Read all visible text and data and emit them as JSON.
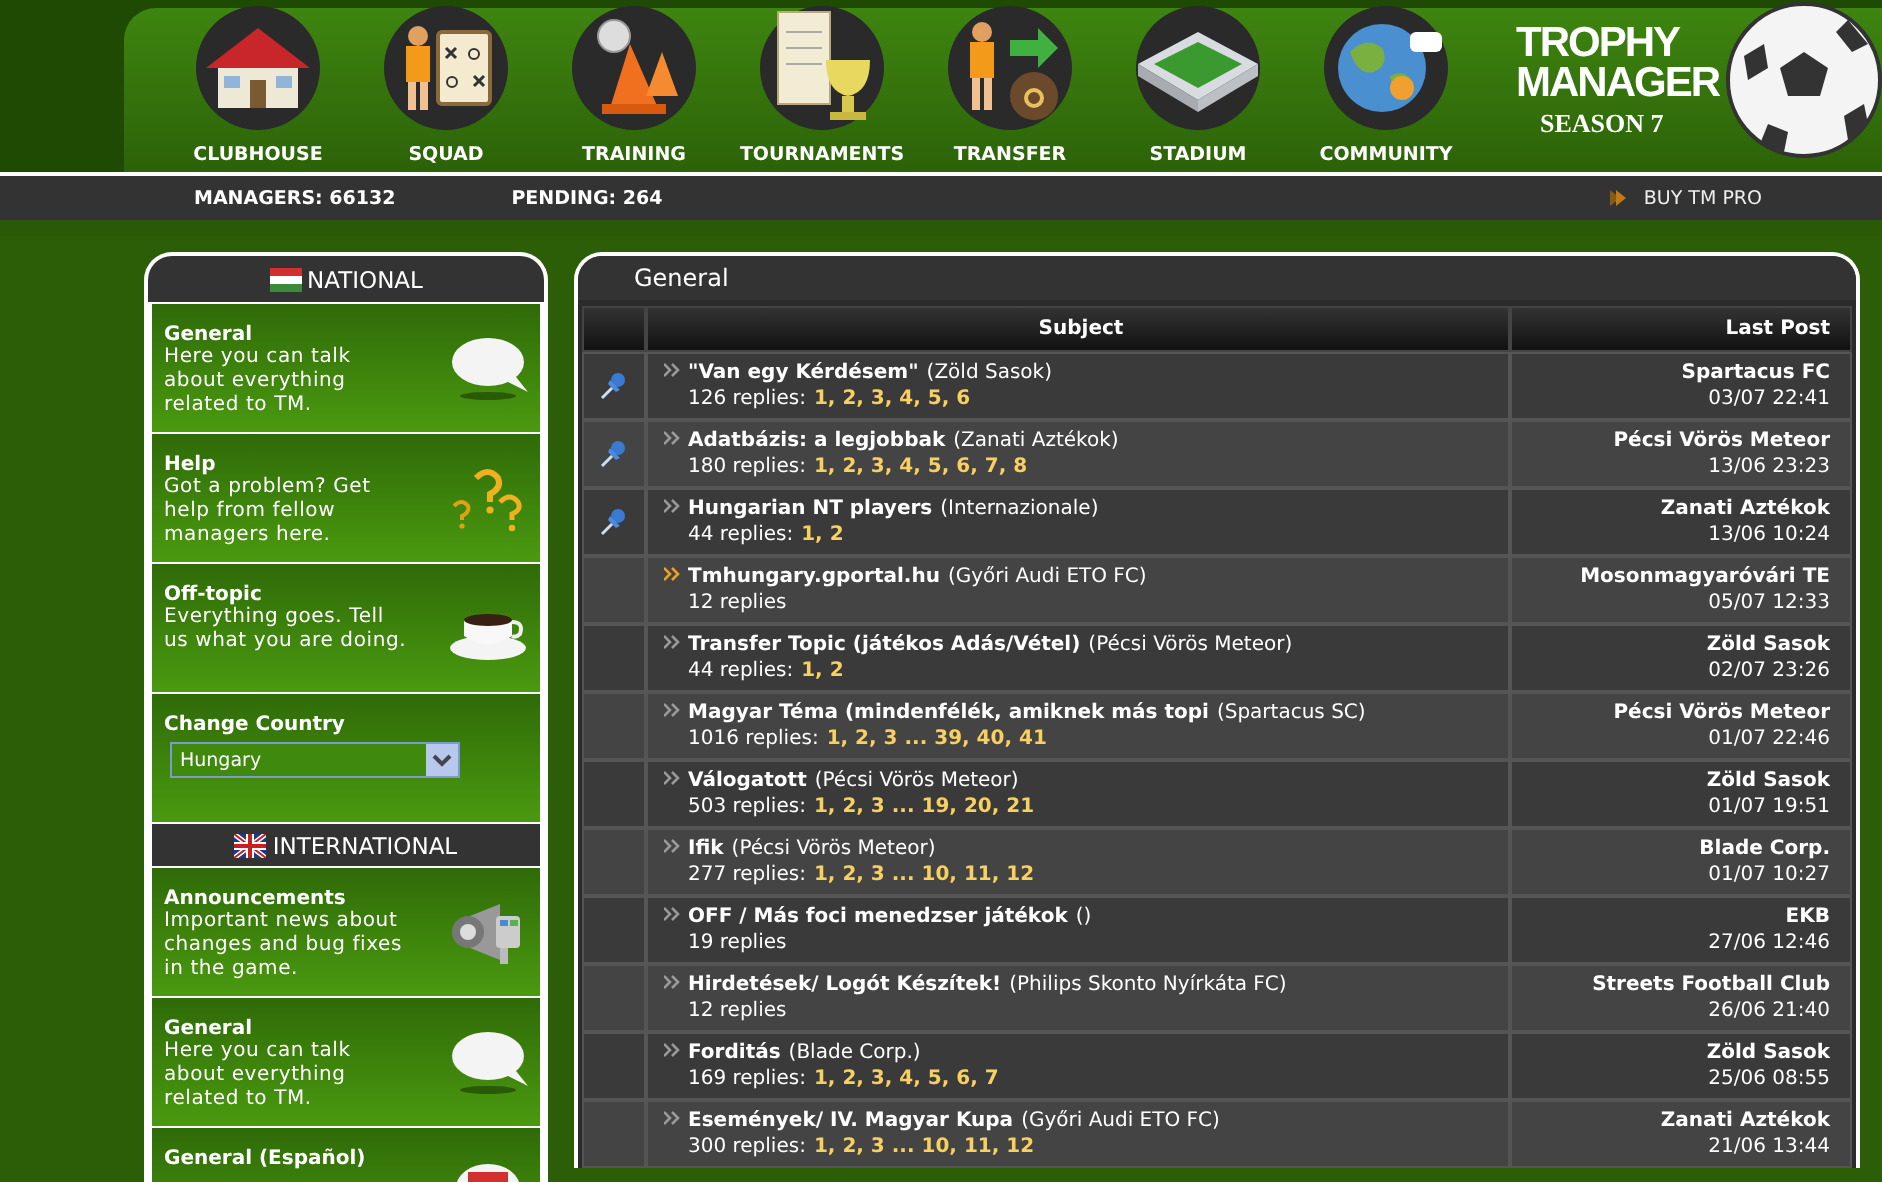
{
  "nav": [
    {
      "label": "CLUBHOUSE",
      "kind": "house"
    },
    {
      "label": "SQUAD",
      "kind": "board"
    },
    {
      "label": "TRAINING",
      "kind": "cone"
    },
    {
      "label": "TOURNAMENTS",
      "kind": "trophy"
    },
    {
      "label": "TRANSFER",
      "kind": "moneybag"
    },
    {
      "label": "STADIUM",
      "kind": "stadium"
    },
    {
      "label": "COMMUNITY",
      "kind": "globe"
    }
  ],
  "logo": {
    "line_1": "TROPHY",
    "line_2": "MANAGER",
    "season": "SEASON 7"
  },
  "stats": {
    "managers": "MANAGERS: 66132",
    "pending": "PENDING: 264",
    "pro_link": "BUY TM PRO"
  },
  "sidebar": [
    {
      "kind": "section",
      "title": "NATIONAL"
    },
    {
      "kind": "forum",
      "title": "General",
      "description": "Here you can talk about everything related to TM."
    },
    {
      "kind": "forum",
      "title": "Help",
      "description": "Got a problem? Get help from fellow managers here."
    },
    {
      "kind": "forum",
      "title": "Off-topic",
      "description": "Everything goes. Tell us what you are doing."
    },
    {
      "kind": "country",
      "title": "Change Country",
      "value": "Hungary"
    },
    {
      "kind": "section",
      "title": "INTERNATIONAL"
    },
    {
      "kind": "forum",
      "title": "Announcements",
      "description": "Important news about changes and bug fixes in the game."
    },
    {
      "kind": "forum",
      "title": "General",
      "description": "Here you can talk about everything related to TM."
    },
    {
      "kind": "forum",
      "title": "General (Español)"
    }
  ],
  "forum": {
    "title": "General",
    "columns": [
      "Subject",
      "Last Post"
    ],
    "rows": [
      {
        "pinned": true,
        "unread": false,
        "title": "\"Van egy Kérdésem\"",
        "author": "(Zöld Sasok)",
        "replies": "126 replies:",
        "pages": "1, 2, 3, 4, 5, 6",
        "last_poster": "Spartacus FC",
        "last_time": "03/07 22:41"
      },
      {
        "pinned": true,
        "unread": false,
        "title": "Adatbázis: a legjobbak",
        "author": "(Zanati Aztékok)",
        "replies": "180 replies:",
        "pages": "1, 2, 3, 4, 5, 6, 7, 8",
        "last_poster": "Pécsi Vörös Meteor",
        "last_time": "13/06 23:23"
      },
      {
        "pinned": true,
        "unread": false,
        "title": "Hungarian NT players",
        "author": "(Internazionale)",
        "replies": "44 replies:",
        "pages": "1, 2",
        "last_poster": "Zanati Aztékok",
        "last_time": "13/06 10:24"
      },
      {
        "pinned": false,
        "unread": true,
        "title": "Tmhungary.gportal.hu",
        "author": "(Győri Audi ETO FC)",
        "replies": "12 replies",
        "last_poster": "Mosonmagyaróvári TE",
        "last_time": "05/07 12:33"
      },
      {
        "pinned": false,
        "unread": false,
        "title": "Transfer Topic (játékos Adás/Vétel)",
        "author": "(Pécsi Vörös Meteor)",
        "replies": "44 replies:",
        "pages": "1, 2",
        "last_poster": "Zöld Sasok",
        "last_time": "02/07 23:26"
      },
      {
        "pinned": false,
        "unread": false,
        "title": "Magyar Téma (mindenfélék, amiknek más topi",
        "author": "(Spartacus SC)",
        "replies": "1016 replies:",
        "pages": "1, 2, 3 ... 39, 40, 41",
        "last_poster": "Pécsi Vörös Meteor",
        "last_time": "01/07 22:46"
      },
      {
        "pinned": false,
        "unread": false,
        "title": "Válogatott",
        "author": "(Pécsi Vörös Meteor)",
        "replies": "503 replies:",
        "pages": "1, 2, 3 ... 19, 20, 21",
        "last_poster": "Zöld Sasok",
        "last_time": "01/07 19:51"
      },
      {
        "pinned": false,
        "unread": false,
        "title": "Ifik",
        "author": "(Pécsi Vörös Meteor)",
        "replies": "277 replies:",
        "pages": "1, 2, 3 ... 10, 11, 12",
        "last_poster": "Blade Corp.",
        "last_time": "01/07 10:27"
      },
      {
        "pinned": false,
        "unread": false,
        "title": "OFF / Más foci menedzser játékok",
        "author": "()",
        "replies": "19 replies",
        "last_poster": "EKB",
        "last_time": "27/06 12:46"
      },
      {
        "pinned": false,
        "unread": false,
        "title": "Hirdetések/ Logót Készítek!",
        "author": "(Philips Skonto Nyírkáta FC)",
        "replies": "12 replies",
        "last_poster": "Streets Football Club",
        "last_time": "26/06 21:40"
      },
      {
        "pinned": false,
        "unread": false,
        "title": "Forditás",
        "author": "(Blade Corp.)",
        "replies": "169 replies:",
        "pages": "1, 2, 3, 4, 5, 6, 7",
        "last_poster": "Zöld Sasok",
        "last_time": "25/06 08:55"
      },
      {
        "pinned": false,
        "unread": false,
        "title": "Események/ IV. Magyar Kupa",
        "author": "(Győri Audi ETO FC)",
        "replies": "300 replies:",
        "pages": "1, 2, 3 ... 10, 11, 12",
        "last_poster": "Zanati Aztékok",
        "last_time": "21/06 13:44"
      }
    ]
  }
}
